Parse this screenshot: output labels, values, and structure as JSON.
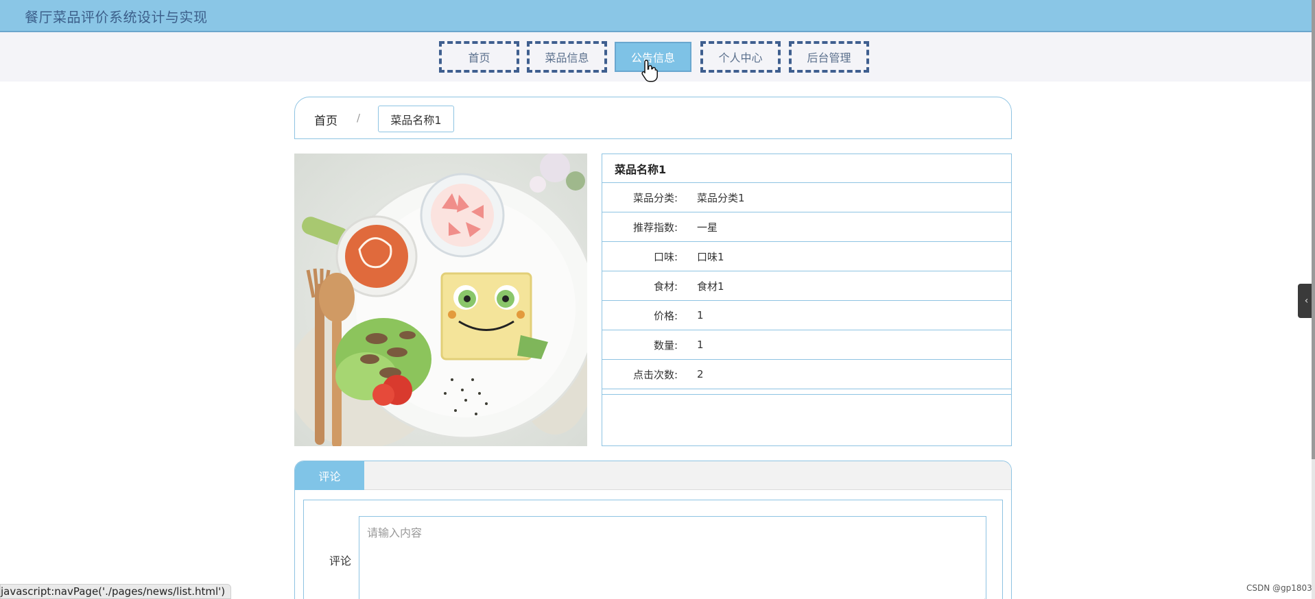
{
  "header": {
    "title": "餐厅菜品评价系统设计与实现"
  },
  "nav": {
    "items": [
      {
        "label": "首页",
        "active": false
      },
      {
        "label": "菜品信息",
        "active": false
      },
      {
        "label": "公告信息",
        "active": true
      },
      {
        "label": "个人中心",
        "active": false
      },
      {
        "label": "后台管理",
        "active": false
      }
    ]
  },
  "breadcrumb": {
    "home": "首页",
    "separator": "/",
    "current": "菜品名称1"
  },
  "product": {
    "name": "菜品名称1",
    "fields": [
      {
        "label": "菜品分类:",
        "value": "菜品分类1"
      },
      {
        "label": "推荐指数:",
        "value": "一星"
      },
      {
        "label": "口味:",
        "value": "口味1"
      },
      {
        "label": "食材:",
        "value": "食材1"
      },
      {
        "label": "价格:",
        "value": "1"
      },
      {
        "label": "数量:",
        "value": "1"
      },
      {
        "label": "点击次数:",
        "value": "2"
      }
    ]
  },
  "comments": {
    "tab_label": "评论",
    "field_label": "评论",
    "placeholder": "请输入内容"
  },
  "status_bar": {
    "url": "javascript:navPage('./pages/news/list.html')"
  },
  "watermark": "CSDN @gp1803",
  "colors": {
    "header_bg": "#8ac6e6",
    "accent": "#80c4e7",
    "border": "#8dc3e2",
    "nav_dash": "#3f5f8f"
  }
}
